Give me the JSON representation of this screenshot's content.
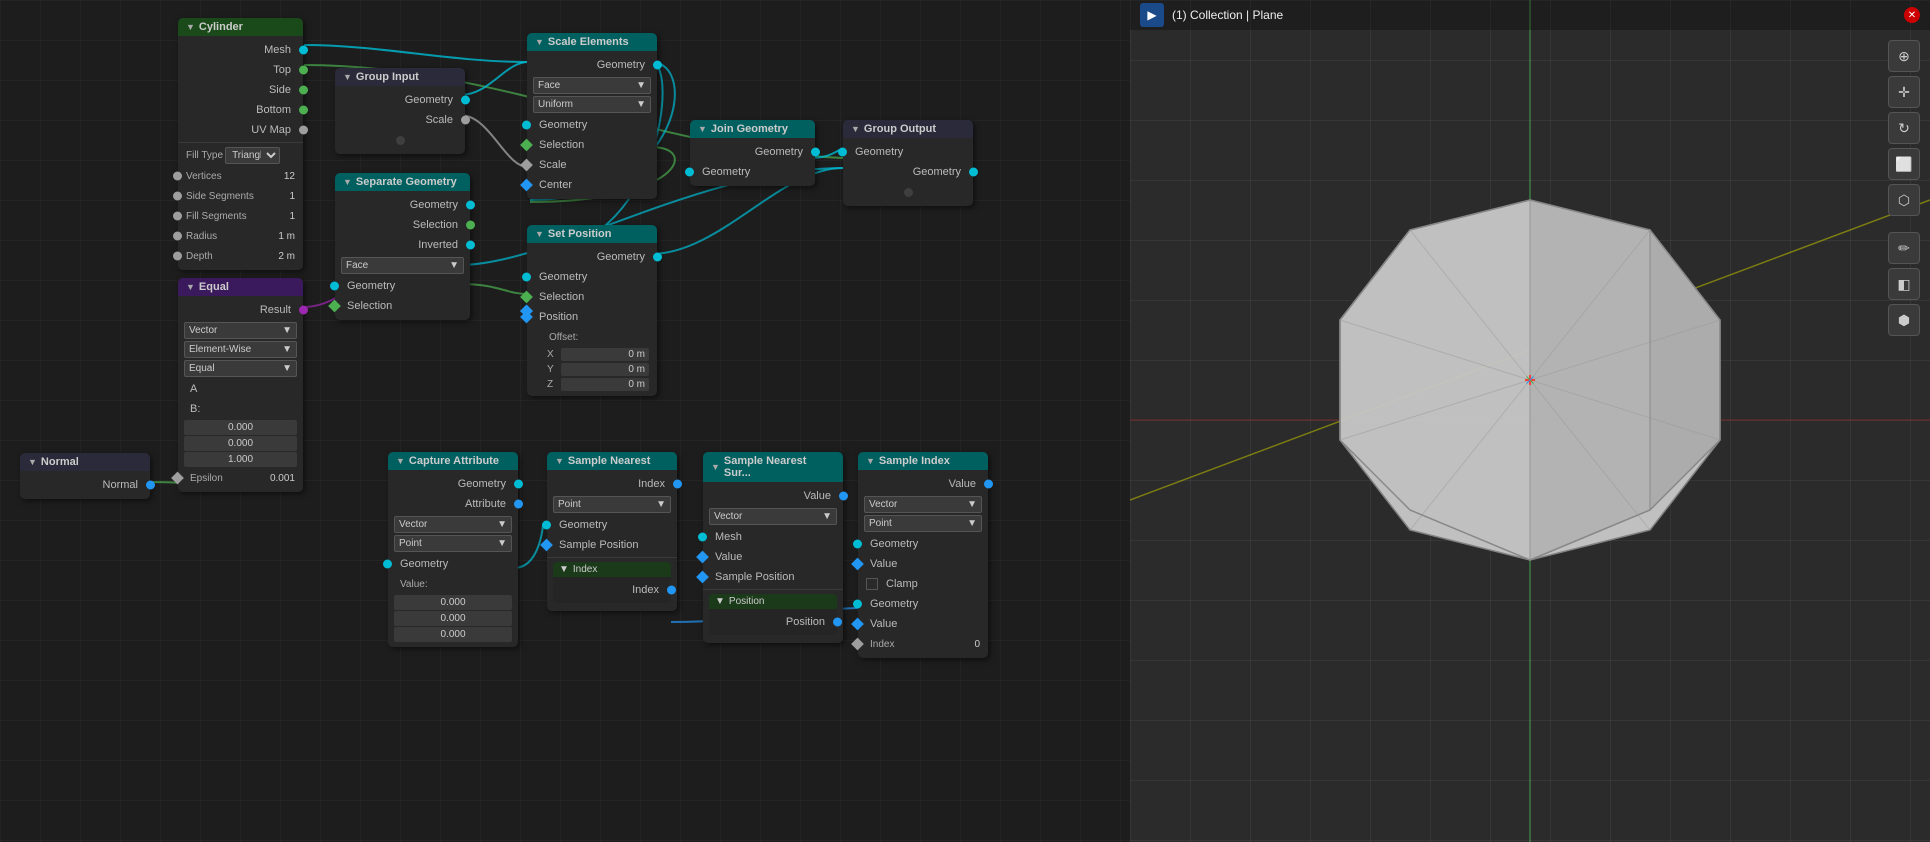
{
  "viewport": {
    "title": "(1) Collection | Plane",
    "background_color": "#2b2b2b"
  },
  "toolbar": {
    "buttons": [
      "⊕",
      "✛",
      "↻",
      "▣",
      "⬡",
      "✏",
      "◧",
      "⬢"
    ]
  },
  "nodes": {
    "cylinder": {
      "title": "Cylinder",
      "header_color": "#2a5a2a",
      "outputs": [
        "Mesh",
        "Top",
        "Side",
        "Bottom",
        "UV Map"
      ],
      "fill_type": "Triangl...",
      "fields": [
        {
          "label": "Vertices",
          "value": "12"
        },
        {
          "label": "Side Segments",
          "value": "1"
        },
        {
          "label": "Fill Segments",
          "value": "1"
        },
        {
          "label": "Radius",
          "value": "1 m"
        },
        {
          "label": "Depth",
          "value": "2 m"
        }
      ]
    },
    "group_input": {
      "title": "Group Input",
      "header_color": "#2a2a4a",
      "outputs": [
        "Geometry",
        "Scale"
      ]
    },
    "scale_elements": {
      "title": "Scale Elements",
      "header_color": "#2a4a4a",
      "input": "Geometry",
      "outputs": [
        "Geometry",
        "Selection",
        "Scale",
        "Center"
      ],
      "face_dropdown": "Face",
      "uniform_dropdown": "Uniform"
    },
    "separate_geometry": {
      "title": "Separate Geometry",
      "header_color": "#2a4a4a",
      "outputs": [
        "Geometry",
        "Selection",
        "Inverted"
      ],
      "face_dropdown": "Face"
    },
    "join_geometry": {
      "title": "Join Geometry",
      "header_color": "#2a4a4a",
      "input": "Geometry",
      "output": "Geometry"
    },
    "group_output": {
      "title": "Group Output",
      "header_color": "#2a2a4a",
      "input": "Geometry",
      "output": "Geometry"
    },
    "equal": {
      "title": "Equal",
      "header_color": "#3a2a5a",
      "output": "Result",
      "dropdowns": [
        "Vector",
        "Element-Wise",
        "Equal"
      ],
      "inputs": [
        "A",
        "B:"
      ],
      "values": [
        "0.000",
        "0.000",
        "1.000"
      ],
      "epsilon_label": "Epsilon",
      "epsilon_value": "0.001"
    },
    "normal": {
      "title": "Normal",
      "header_color": "#2a2a4a",
      "output": "Normal"
    },
    "set_position": {
      "title": "Set Position",
      "header_color": "#2a4a4a",
      "output": "Geometry",
      "inputs": [
        "Geometry",
        "Selection",
        "Position",
        "Offset:"
      ],
      "xyz": [
        {
          "label": "X",
          "value": "0 m"
        },
        {
          "label": "Y",
          "value": "0 m"
        },
        {
          "label": "Z",
          "value": "0 m"
        }
      ]
    },
    "capture_attribute": {
      "title": "Capture Attribute",
      "header_color": "#2a4a4a",
      "inputs": [
        "Geometry",
        "Attribute"
      ],
      "outputs": [
        "Geometry",
        "Value:"
      ],
      "dropdowns": [
        "Vector",
        "Point"
      ],
      "value_rows": [
        "0.000",
        "0.000",
        "0.000"
      ]
    },
    "sample_nearest": {
      "title": "Sample Nearest",
      "header_color": "#2a4a4a",
      "output": "Index",
      "inputs": [
        "Geometry",
        "Sample Position"
      ],
      "point_dropdown": "Point"
    },
    "sample_nearest_sur": {
      "title": "Sample Nearest Sur...",
      "header_color": "#2a4a4a",
      "output": "Value",
      "inputs": [
        "Mesh",
        "Value",
        "Sample Position"
      ],
      "vector_dropdown": "Vector"
    },
    "sample_index": {
      "title": "Sample Index",
      "header_color": "#2a4a4a",
      "output": "Value",
      "inputs": [
        "Geometry",
        "Value",
        "Clamp"
      ],
      "dropdowns": [
        "Vector",
        "Point"
      ],
      "index_value": "0"
    },
    "index": {
      "title": "Index",
      "output": "Index"
    },
    "position": {
      "title": "Position",
      "output": "Position"
    }
  }
}
